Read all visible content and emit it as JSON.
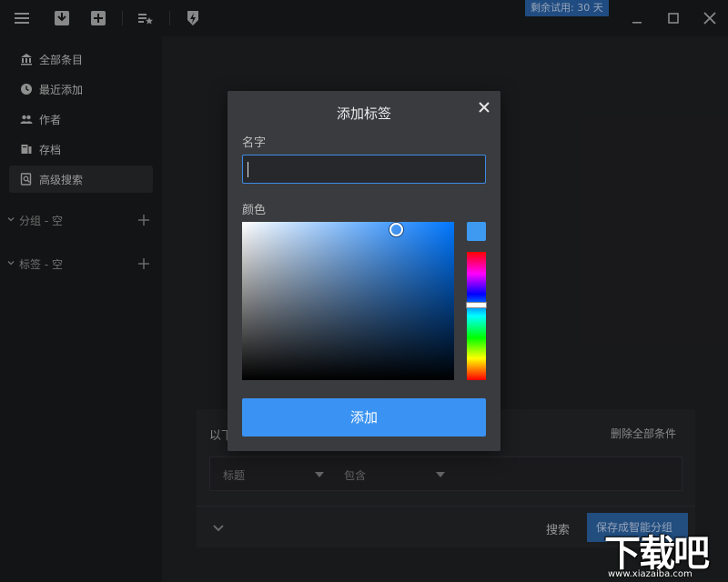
{
  "titlebar": {
    "trial_badge": "剩余试用: 30 天",
    "icons": [
      "menu-icon",
      "inbox-icon",
      "add-icon",
      "list-star-icon",
      "shield-bolt-icon"
    ],
    "window_controls": [
      "minimize-icon",
      "maximize-icon",
      "close-icon"
    ]
  },
  "sidebar": {
    "items": [
      {
        "label": "全部条目",
        "icon": "library-icon",
        "active": false
      },
      {
        "label": "最近添加",
        "icon": "clock-icon",
        "active": false
      },
      {
        "label": "作者",
        "icon": "people-icon",
        "active": false
      },
      {
        "label": "存档",
        "icon": "archive-icon",
        "active": false
      },
      {
        "label": "高级搜索",
        "icon": "advanced-search-icon",
        "active": true
      }
    ],
    "groups": [
      {
        "label": "分组 - 空"
      },
      {
        "label": "标签 - 空"
      }
    ]
  },
  "search_panel": {
    "condition_text": "以下",
    "delete_all": "删除全部条件",
    "field_dropdown": "标题",
    "operator_dropdown": "包含",
    "search_button": "搜索",
    "save_smart_button": "保存成智能分组"
  },
  "modal": {
    "title": "添加标签",
    "name_label": "名字",
    "name_value": "",
    "color_label": "颜色",
    "hue": 212,
    "selected_color": "#3d9af0",
    "add_button": "添加"
  },
  "watermark": {
    "text": "下载吧",
    "sub": "www.xiazaiba.com"
  },
  "colors": {
    "accent": "#3a93f2",
    "background": "#1f2022",
    "dialog": "#3a3b3e"
  }
}
